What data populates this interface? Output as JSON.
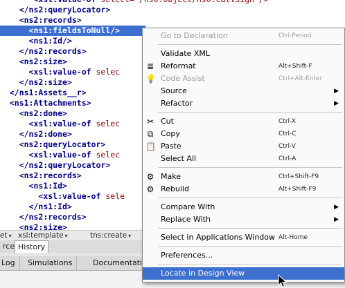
{
  "editor": {
    "lines": [
      {
        "indent": "       ",
        "tag": "<xsl:value-of ",
        "attr": "select=\"/ns0:object/ns0:CallSign\"/>"
      },
      {
        "indent": "    ",
        "tag": "</ns2:queryLocator>",
        "attr": ""
      },
      {
        "indent": "    ",
        "tag": "<ns2:records>",
        "attr": ""
      },
      {
        "indent": "      ",
        "tag": "<ns1:fieldsToNull/>",
        "attr": ""
      },
      {
        "indent": "      ",
        "tag": "<ns1:Id/>",
        "attr": ""
      },
      {
        "indent": "    ",
        "tag": "</ns2:records>",
        "attr": ""
      },
      {
        "indent": "    ",
        "tag": "<ns2:size>",
        "attr": ""
      },
      {
        "indent": "      ",
        "tag": "<xsl:value-of ",
        "attr": "selec"
      },
      {
        "indent": "    ",
        "tag": "</ns2:size>",
        "attr": ""
      },
      {
        "indent": "  ",
        "tag": "</ns1:Assets__r>",
        "attr": ""
      },
      {
        "indent": "  ",
        "tag": "<ns1:Attachments>",
        "attr": ""
      },
      {
        "indent": "    ",
        "tag": "<ns2:done>",
        "attr": ""
      },
      {
        "indent": "      ",
        "tag": "<xsl:value-of ",
        "attr": "selec"
      },
      {
        "indent": "    ",
        "tag": "</ns2:done>",
        "attr": ""
      },
      {
        "indent": "    ",
        "tag": "<ns2:queryLocator>",
        "attr": ""
      },
      {
        "indent": "      ",
        "tag": "<xsl:value-of ",
        "attr": "selec"
      },
      {
        "indent": "    ",
        "tag": "</ns2:queryLocator>",
        "attr": ""
      },
      {
        "indent": "    ",
        "tag": "<ns2:records>",
        "attr": ""
      },
      {
        "indent": "      ",
        "tag": "<ns1:Id>",
        "attr": ""
      },
      {
        "indent": "        ",
        "tag": "<xsl:value-of ",
        "attr": "sele"
      },
      {
        "indent": "      ",
        "tag": "</ns1:Id>",
        "attr": ""
      },
      {
        "indent": "    ",
        "tag": "</ns2:records>",
        "attr": ""
      },
      {
        "indent": "    ",
        "tag": "<ns2:size>",
        "attr": ""
      }
    ],
    "highlighted_line": 3
  },
  "breadcrumbs": {
    "items": [
      "et",
      "xsl:template",
      "tns:create"
    ],
    "arrow": "▾"
  },
  "editor_tabs": [
    {
      "label": "rce",
      "selected": false
    },
    {
      "label": "History",
      "selected": true
    }
  ],
  "bottom_tabs": [
    "Log",
    "Simulations",
    "Documentatio"
  ],
  "context_menu": {
    "items": [
      {
        "type": "item",
        "label": "Go to Declaration",
        "shortcut": "Ctrl-Period",
        "disabled": true,
        "icon": "",
        "icon_name": "",
        "submenu": false
      },
      {
        "type": "sep"
      },
      {
        "type": "item",
        "label": "Validate XML",
        "shortcut": "",
        "disabled": false,
        "icon": "",
        "icon_name": "",
        "submenu": false
      },
      {
        "type": "item",
        "label": "Reformat",
        "shortcut": "Alt+Shift-F",
        "disabled": false,
        "icon": "≣",
        "icon_name": "reformat-icon",
        "submenu": false
      },
      {
        "type": "item",
        "label": "Code Assist",
        "shortcut": "Ctrl+Alt-Enter",
        "disabled": true,
        "icon": "💡",
        "icon_name": "lightbulb-icon",
        "submenu": false
      },
      {
        "type": "item",
        "label": "Source",
        "shortcut": "",
        "disabled": false,
        "icon": "",
        "icon_name": "",
        "submenu": true
      },
      {
        "type": "item",
        "label": "Refactor",
        "shortcut": "",
        "disabled": false,
        "icon": "",
        "icon_name": "",
        "submenu": true
      },
      {
        "type": "sep"
      },
      {
        "type": "item",
        "label": "Cut",
        "shortcut": "Ctrl-X",
        "disabled": false,
        "icon": "✂",
        "icon_name": "scissors-icon",
        "submenu": false
      },
      {
        "type": "item",
        "label": "Copy",
        "shortcut": "Ctrl-C",
        "disabled": false,
        "icon": "⧉",
        "icon_name": "copy-icon",
        "submenu": false
      },
      {
        "type": "item",
        "label": "Paste",
        "shortcut": "Ctrl-V",
        "disabled": false,
        "icon": "📋",
        "icon_name": "paste-icon",
        "submenu": false
      },
      {
        "type": "item",
        "label": "Select All",
        "shortcut": "Ctrl-A",
        "disabled": false,
        "icon": "",
        "icon_name": "",
        "submenu": false
      },
      {
        "type": "sep"
      },
      {
        "type": "item",
        "label": "Make",
        "shortcut": "Ctrl+Shift-F9",
        "disabled": false,
        "icon": "⚙",
        "icon_name": "make-icon",
        "submenu": false
      },
      {
        "type": "item",
        "label": "Rebuild",
        "shortcut": "Alt+Shift-F9",
        "disabled": false,
        "icon": "⚙",
        "icon_name": "rebuild-icon",
        "submenu": false
      },
      {
        "type": "sep"
      },
      {
        "type": "item",
        "label": "Compare With",
        "shortcut": "",
        "disabled": false,
        "icon": "",
        "icon_name": "",
        "submenu": true
      },
      {
        "type": "item",
        "label": "Replace With",
        "shortcut": "",
        "disabled": false,
        "icon": "",
        "icon_name": "",
        "submenu": true
      },
      {
        "type": "sep"
      },
      {
        "type": "item",
        "label": "Select in Applications Window",
        "shortcut": "Alt-Home",
        "disabled": false,
        "icon": "",
        "icon_name": "",
        "submenu": false
      },
      {
        "type": "sep"
      },
      {
        "type": "item",
        "label": "Preferences...",
        "shortcut": "",
        "disabled": false,
        "icon": "",
        "icon_name": "",
        "submenu": false
      },
      {
        "type": "sep"
      },
      {
        "type": "item",
        "label": "Locate in Design View",
        "shortcut": "",
        "disabled": false,
        "icon": "",
        "icon_name": "",
        "submenu": false,
        "active": true
      }
    ],
    "submenu_arrow": "▶"
  },
  "colors": {
    "selection": "#3d6fcf",
    "tag": "#000080",
    "attribute": "#8b0000"
  }
}
